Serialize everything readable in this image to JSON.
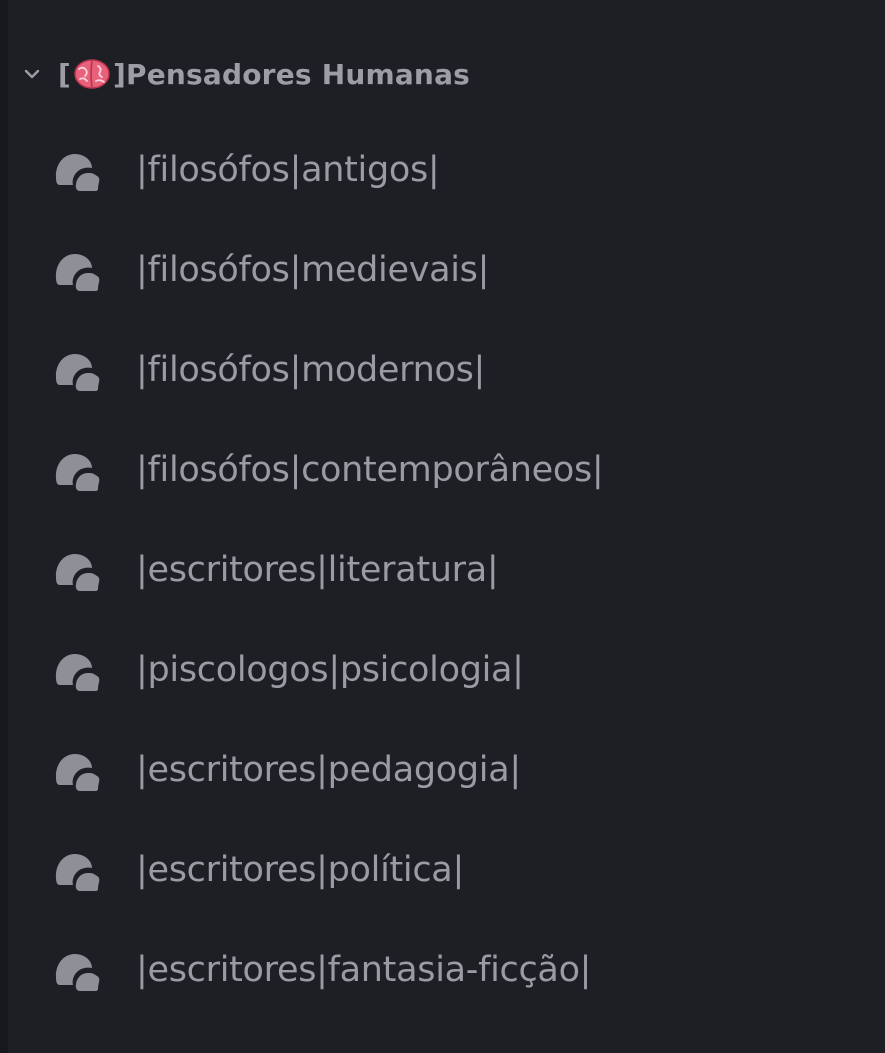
{
  "category": {
    "title_prefix": "[",
    "title_suffix": "]Pensadores Humanas",
    "emoji": "brain",
    "expanded": true
  },
  "channels": [
    {
      "label": "|filosófos|antigos|"
    },
    {
      "label": "|filosófos|medievais|"
    },
    {
      "label": "|filosófos|modernos|"
    },
    {
      "label": "|filosófos|contemporâneos|"
    },
    {
      "label": "|escritores|literatura|"
    },
    {
      "label": "|piscologos|psicologia|"
    },
    {
      "label": "|escritores|pedagogia|"
    },
    {
      "label": "|escritores|política|"
    },
    {
      "label": "|escritores|fantasia-ficção|"
    }
  ],
  "colors": {
    "background": "#1e1f24",
    "text": "#9a9ba3",
    "icon": "#8e8f97",
    "brain": "#e8607a"
  },
  "icons": {
    "chevron": "chevron-down-icon",
    "channel": "forum-channel-icon"
  }
}
